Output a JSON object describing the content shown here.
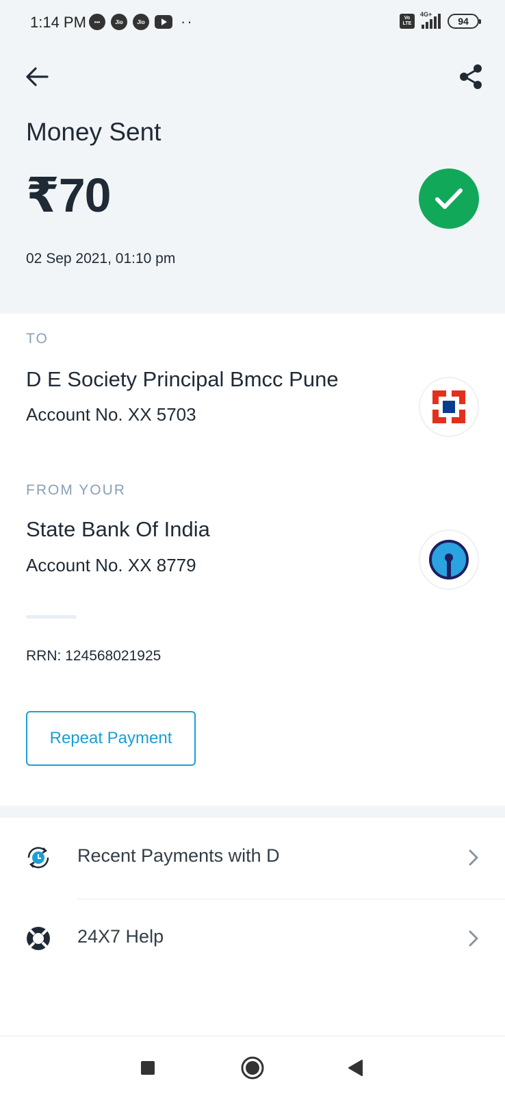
{
  "status_bar": {
    "time": "1:14 PM",
    "notifications": [
      "chat-bubble-icon",
      "jio-icon",
      "jio-icon",
      "youtube-icon"
    ],
    "notif_jio_label": "Jio",
    "network_label": "4G+",
    "volte_label": "Vo LTE",
    "battery": "94"
  },
  "header": {
    "title": "Money Sent",
    "amount": "₹70",
    "datetime": "02 Sep 2021, 01:10 pm",
    "status": "success",
    "status_color": "#12a85a"
  },
  "to": {
    "label": "TO",
    "name": "D E Society Principal Bmcc Pune",
    "account": "Account No. XX 5703",
    "bank_icon": "hdfc-bank-logo"
  },
  "from": {
    "label": "FROM YOUR",
    "name": "State Bank Of India",
    "account": "Account No. XX 8779",
    "bank_icon": "sbi-bank-logo"
  },
  "rrn": "RRN: 124568021925",
  "actions": {
    "repeat_payment": "Repeat Payment"
  },
  "list": [
    {
      "label": "Recent Payments with D",
      "icon": "recent-clock-icon"
    },
    {
      "label": "24X7 Help",
      "icon": "lifebuoy-help-icon"
    }
  ],
  "nav": [
    "recents-square-icon",
    "home-circle-icon",
    "back-triangle-icon"
  ],
  "colors": {
    "accent": "#1a9ed6",
    "success": "#12a85a",
    "header_bg": "#f2f5f7",
    "muted_label": "#8aa0b4"
  }
}
